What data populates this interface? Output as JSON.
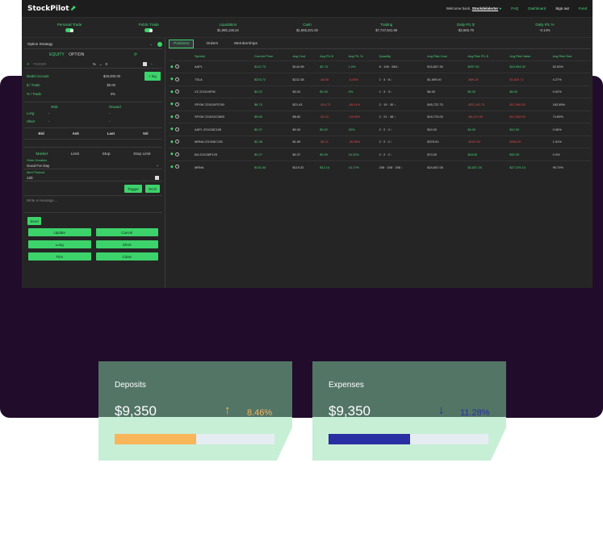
{
  "app": {
    "logo_text": "StockPilot",
    "welcome_text": "Welcome back,",
    "username": "Stockdelalerter",
    "nav": [
      "FAQ",
      "Dashboard",
      "Sign out",
      "Fund"
    ]
  },
  "stats": [
    {
      "label": "Personal Trade",
      "toggle": true
    },
    {
      "label": "Public Trade",
      "toggle": true
    },
    {
      "label": "Liquidation",
      "value": "$1,955,136.24"
    },
    {
      "label": "Cash",
      "value": "$1,665,221.00"
    },
    {
      "label": "Trading",
      "value": "$7,747,841.98"
    },
    {
      "label": "Daily P/L $",
      "value": "-$2,565.79"
    },
    {
      "label": "Daily P/L %",
      "value": "-0.14%"
    }
  ],
  "order": {
    "strategy": "Option Strategy",
    "equity_label": "EQUITY",
    "option_label": "OPTION",
    "ticker_placeholder": "TICKER",
    "percent_symbol": "%",
    "qty": "0",
    "model_account_label": "Model Account",
    "model_account_value": "$25,000.00",
    "per_trade_label": "$ / Trade",
    "per_trade_value": "$0.00",
    "pct_trade_label": "% / Trade",
    "pct_trade_value": "0%",
    "leg_button": "+ leg",
    "risk_header": "Risk",
    "reward_header": "Reward",
    "long_label": "Long",
    "short_label": "Short",
    "dash": "-",
    "bid_label": "Bid",
    "ask_label": "Ask",
    "last_label": "Last",
    "vol_label": "Vol",
    "order_types": [
      "Market",
      "Limit",
      "Stop",
      "Stop Limit"
    ],
    "order_duration_label": "Order Duration",
    "order_duration_value": "Good For Day",
    "alert_timeout_label": "Alert Timeout",
    "alert_timeout_value": "120",
    "trigger_button": "Trigger",
    "oco_button": "OCO",
    "message_placeholder": "Write a message ...",
    "send_button": "Send",
    "actions": [
      "Update",
      "Cancel",
      "Long",
      "Short",
      "Trim",
      "Close"
    ]
  },
  "tabs": [
    "Positions",
    "Orders",
    "Memberships"
  ],
  "table": {
    "columns": [
      "Symbol",
      "Current Price",
      "Avg Cost",
      "Avg P/L $",
      "Avg P/L %",
      "Quantity",
      "Avg Risk Cost",
      "Avg Risk P/L $",
      "Avg Risk Value",
      "Avg Risk Size"
    ],
    "rows": [
      {
        "symbol": "AAPL",
        "price": "$147.73",
        "cost": "$144.98",
        "pl": "$2.75",
        "plpct": "1.9%",
        "qty": "6 · 108 · 288 ↓",
        "rcost": "$15,657.30",
        "rpl": "$297.00",
        "rval": "$15,954.30",
        "rsize": "62.63%",
        "neg": false
      },
      {
        "symbol": "TSLA",
        "price": "$203.72",
        "cost": "$212.38",
        "pl": "-$8.66",
        "plpct": "-4.08%",
        "qty": "1 · 3 · 8 ↓",
        "rcost": "$1,699.00",
        "rpl": "-$69.28",
        "rval": "$1,629.72",
        "rsize": "4.27%",
        "neg": true
      },
      {
        "symbol": "VZ 221104P35",
        "price": "$0.02",
        "cost": "$0.02",
        "pl": "$0.00",
        "plpct": "0%",
        "qty": "1 · 3 · 3 ↓",
        "rcost": "$6.00",
        "rpl": "$0.00",
        "rval": "$6.00",
        "rsize": "0.02%",
        "neg": false
      },
      {
        "symbol": "SPXW 221024P3760",
        "price": "$6.70",
        "cost": "$21.43",
        "pl": "-$14.73",
        "plpct": "-68.41%",
        "qty": "2 · 15 · 30 ↓",
        "rcost": "$45,722.70",
        "rpl": "-$33,162.70",
        "rval": "$12,560.00",
        "rsize": "182.89%",
        "neg": true
      },
      {
        "symbol": "SPXW 221024C3800",
        "price": "$5.60",
        "cost": "$8.82",
        "pl": "-$3.22",
        "plpct": "-43.65%",
        "qty": "2 · 21 · 48 ↓",
        "rcost": "$18,723.00",
        "rpl": "-$6,223.00",
        "rval": "$12,500.00",
        "rsize": "74.89%",
        "neg": true
      },
      {
        "symbol": "AAPL 221028C165",
        "price": "$0.37",
        "cost": "$0.00",
        "pl": "$0.02",
        "plpct": "20%",
        "qty": "2 · 2 · 2 ↓",
        "rcost": "$10.00",
        "rpl": "$4.00",
        "rval": "$12.00",
        "rsize": "0.06%",
        "neg": false
      },
      {
        "symbol": "MRNA 221028C135",
        "price": "$2.36",
        "cost": "$1.89",
        "pl": "-$0.11",
        "plpct": "-38.36%",
        "qty": "2 · 2 · 2 ↓",
        "rcost": "$378.00",
        "rpl": "-$102.00",
        "rval": "$466.00",
        "rsize": "1.51%",
        "neg": true
      },
      {
        "symbol": "BA 221028P125",
        "price": "$0.27",
        "cost": "$0.37",
        "pl": "$0.09",
        "plpct": "24.32%",
        "qty": "2 · 2 · 2 ↓",
        "rcost": "$74.00",
        "rpl": "$18.00",
        "rval": "$92.00",
        "rsize": "0.3%",
        "neg": false
      },
      {
        "symbol": "MRNA",
        "price": "$131.54",
        "cost": "$119.32",
        "pl": "$12.14",
        "plpct": "10.17%",
        "qty": "208 · 208 · 208 ↓",
        "rcost": "$24,657.06",
        "rpl": "$2,537.25",
        "rval": "$27,475.14",
        "rsize": "99.70%",
        "neg": false
      }
    ]
  },
  "cards": [
    {
      "title": "Deposits",
      "amount": "$9,350",
      "trend_icon": "arrow-up-icon",
      "trend_glyph": "↑",
      "pct": "8.46%",
      "progress": 0.51,
      "color": "#f8b55a"
    },
    {
      "title": "Expenses",
      "amount": "$9,350",
      "trend_icon": "arrow-down-icon",
      "trend_glyph": "↓",
      "pct": "11.28%",
      "progress": 0.51,
      "color": "#2a2ea3"
    }
  ],
  "colors": {
    "accent": "#3dd36b",
    "negative": "#e04848",
    "purple_bg": "#220c2c",
    "card_top": "#527566",
    "card_bottom": "#c7efd6"
  }
}
